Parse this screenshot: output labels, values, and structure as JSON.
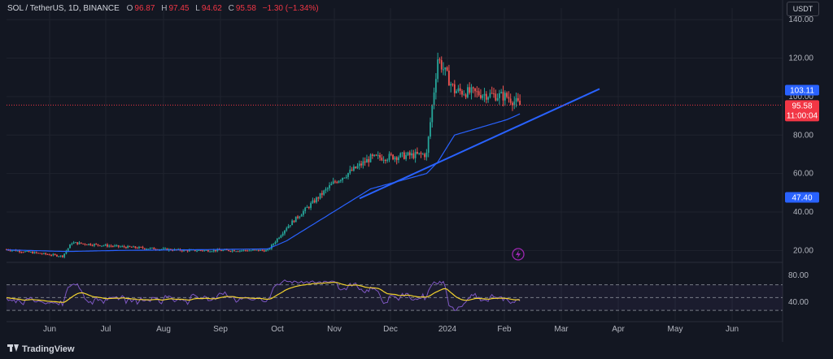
{
  "legend": {
    "symbol": "SOL / TetherUS, 1D, BINANCE",
    "o_label": "O",
    "o_value": "96.87",
    "h_label": "H",
    "h_value": "97.45",
    "l_label": "L",
    "l_value": "94.62",
    "c_label": "C",
    "c_value": "95.58",
    "change": "−1.30 (−1.34%)"
  },
  "currency_button": "USDT",
  "price_axis": {
    "labels": [
      "140.00",
      "120.00",
      "100.00",
      "80.00",
      "60.00",
      "40.00",
      "20.00"
    ],
    "values": [
      140,
      120,
      100,
      80,
      60,
      40,
      20
    ]
  },
  "rsi_axis": {
    "labels": [
      "80.00",
      "40.00"
    ],
    "values": [
      80,
      40
    ]
  },
  "tags": {
    "ma_value": "103.11",
    "last_price": "95.58",
    "countdown": "11:00:04",
    "ma2_value": "47.40"
  },
  "time_axis": [
    "Jun",
    "Jul",
    "Aug",
    "Sep",
    "Oct",
    "Nov",
    "Dec",
    "2024",
    "Feb",
    "Mar",
    "Apr",
    "May",
    "Jun"
  ],
  "footer": {
    "brand": "TradingView"
  },
  "colors": {
    "up": "#26a69a",
    "down": "#ef5350",
    "ma": "#2962ff",
    "trend": "#2962ff",
    "rsi": "#7e57c2",
    "rsi_ma": "#f2d22e",
    "price_line": "#f23645",
    "bg": "#131722"
  },
  "icons": {
    "replay": "lightning-icon",
    "logo": "tradingview-logo-icon"
  },
  "chart_data": {
    "type": "candlestick",
    "symbol": "SOL / TetherUS",
    "interval": "1D",
    "x": [
      "Jun",
      "Jul",
      "Aug",
      "Sep",
      "Oct",
      "Nov",
      "Dec",
      "2024",
      "Feb"
    ],
    "series": [
      {
        "values": [
          20.5,
          17.0,
          24.0,
          22.0,
          20.0,
          20.0,
          32.0,
          55.0,
          68.0,
          70.0,
          120.0,
          103.0,
          100.0,
          95.58
        ]
      },
      {
        "values": [
          20.3,
          19.5,
          19.5,
          20.0,
          20.3,
          20.8,
          25.0,
          40.0,
          52.0,
          60.0,
          66.0,
          80.0,
          88.0,
          91.0
        ]
      }
    ],
    "ylim": [
      10,
      146
    ],
    "rsi_ylim": [
      20,
      100
    ],
    "trendline": [
      [
        46.5,
        47.0
      ],
      [
        136.0,
        104.0
      ]
    ]
  }
}
